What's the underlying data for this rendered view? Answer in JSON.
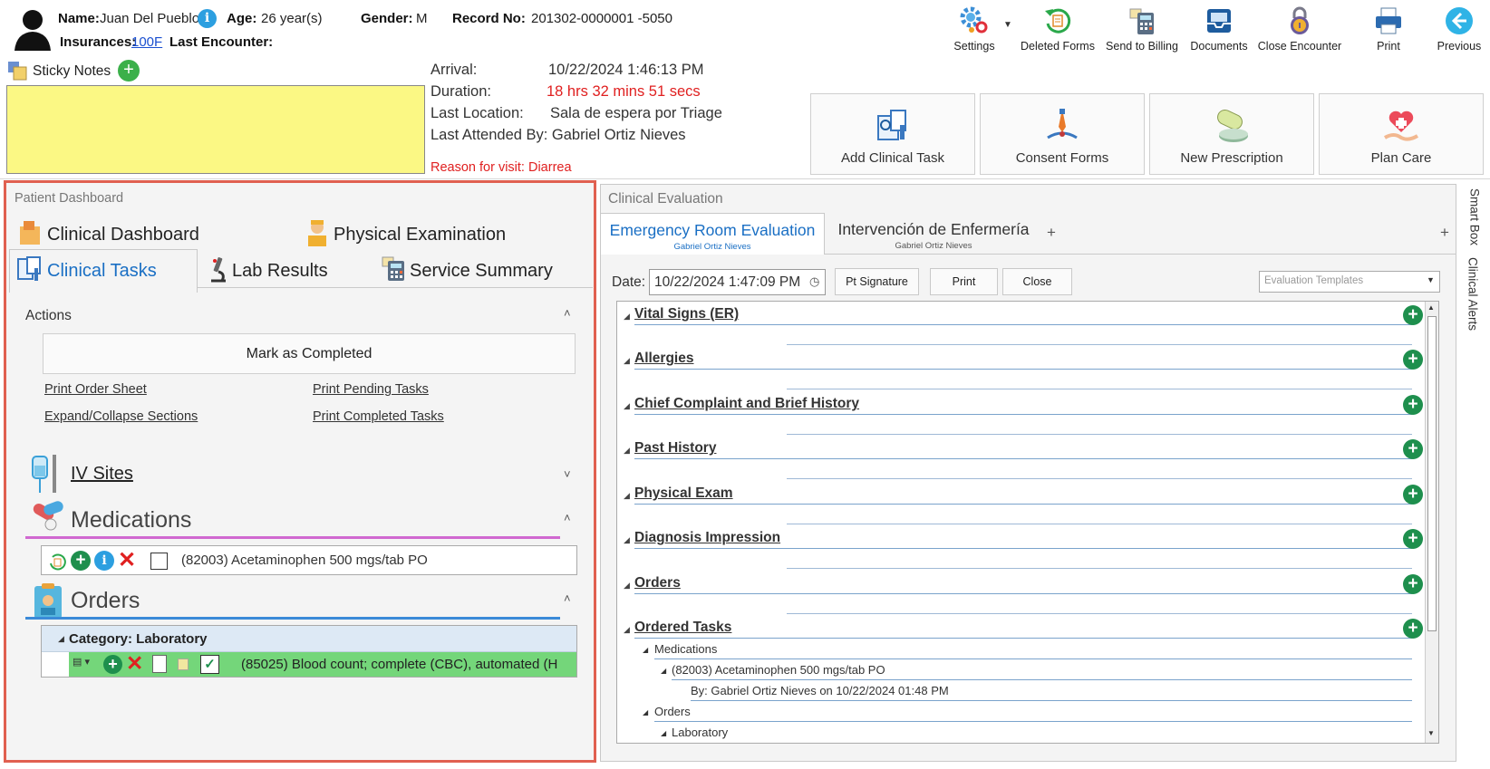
{
  "header": {
    "name_label": "Name:",
    "name": "Juan Del Pueblo",
    "age_label": "Age:",
    "age": "26 year(s)",
    "gender_label": "Gender:",
    "gender": "M",
    "record_label": "Record No:",
    "record": "201302-0000001 -5050",
    "insurances_label": "Insurances:",
    "insurance": "100F",
    "last_encounter_label": "Last Encounter:"
  },
  "toolbar": {
    "settings": "Settings",
    "deleted_forms": "Deleted Forms",
    "send_to_billing": "Send to Billing",
    "documents": "Documents",
    "close_encounter": "Close Encounter",
    "print": "Print",
    "previous": "Previous"
  },
  "sticky": {
    "label": "Sticky Notes"
  },
  "encounter": {
    "arrival_label": "Arrival:",
    "arrival": "10/22/2024 1:46:13 PM",
    "duration_label": "Duration:",
    "duration": "18 hrs 32 mins 51 secs",
    "last_location_label": "Last Location:",
    "last_location": "Sala de espera por Triage",
    "last_attended": "Last Attended By: Gabriel Ortiz Nieves",
    "reason": "Reason for visit: Diarrea"
  },
  "actions_big": {
    "add_clinical_task": "Add Clinical Task",
    "consent_forms": "Consent Forms",
    "new_prescription": "New Prescription",
    "plan_care": "Plan Care"
  },
  "left": {
    "title": "Patient Dashboard",
    "tabs": {
      "clinical_dashboard": "Clinical Dashboard",
      "physical_examination": "Physical Examination",
      "clinical_tasks": "Clinical Tasks",
      "lab_results": "Lab Results",
      "service_summary": "Service Summary"
    },
    "actions_label": "Actions",
    "mark_completed": "Mark as Completed",
    "links": {
      "print_order_sheet": "Print Order Sheet",
      "print_pending": "Print Pending Tasks",
      "expand_collapse": "Expand/Collapse Sections",
      "print_completed": "Print Completed Tasks"
    },
    "iv_sites": "IV Sites",
    "medications": "Medications",
    "medication_item": "(82003) Acetaminophen 500 mgs/tab PO",
    "orders": "Orders",
    "category": "Category: Laboratory",
    "order_item": "(85025) Blood count; complete (CBC), automated (H"
  },
  "right": {
    "title": "Clinical Evaluation",
    "tab1": "Emergency Room Evaluation",
    "tab1_sub": "Gabriel Ortiz Nieves",
    "tab2": "Intervención de Enfermería",
    "tab2_sub": "Gabriel Ortiz Nieves",
    "date_label": "Date:",
    "date": "10/22/2024 1:47:09 PM",
    "pt_signature": "Pt Signature",
    "print": "Print",
    "close": "Close",
    "templates_placeholder": "Evaluation Templates",
    "sections": [
      "Vital Signs (ER)",
      "Allergies",
      "Chief Complaint and Brief History",
      "Past History",
      "Physical Exam",
      "Diagnosis Impression",
      "Orders",
      "Ordered Tasks"
    ],
    "ordered": {
      "medications": "Medications",
      "med_item": "(82003) Acetaminophen 500 mgs/tab PO",
      "med_by": "By: Gabriel Ortiz Nieves on 10/22/2024 01:48 PM",
      "orders": "Orders",
      "laboratory": "Laboratory"
    }
  },
  "side": {
    "smart_box": "Smart Box",
    "clinical_alerts": "Clinical Alerts"
  },
  "colors": {
    "accent_blue": "#1a6fc4",
    "red": "#e02020",
    "highlight_border": "#e06050",
    "green": "#1e8f4d",
    "sticky_yellow": "#fbf884"
  }
}
